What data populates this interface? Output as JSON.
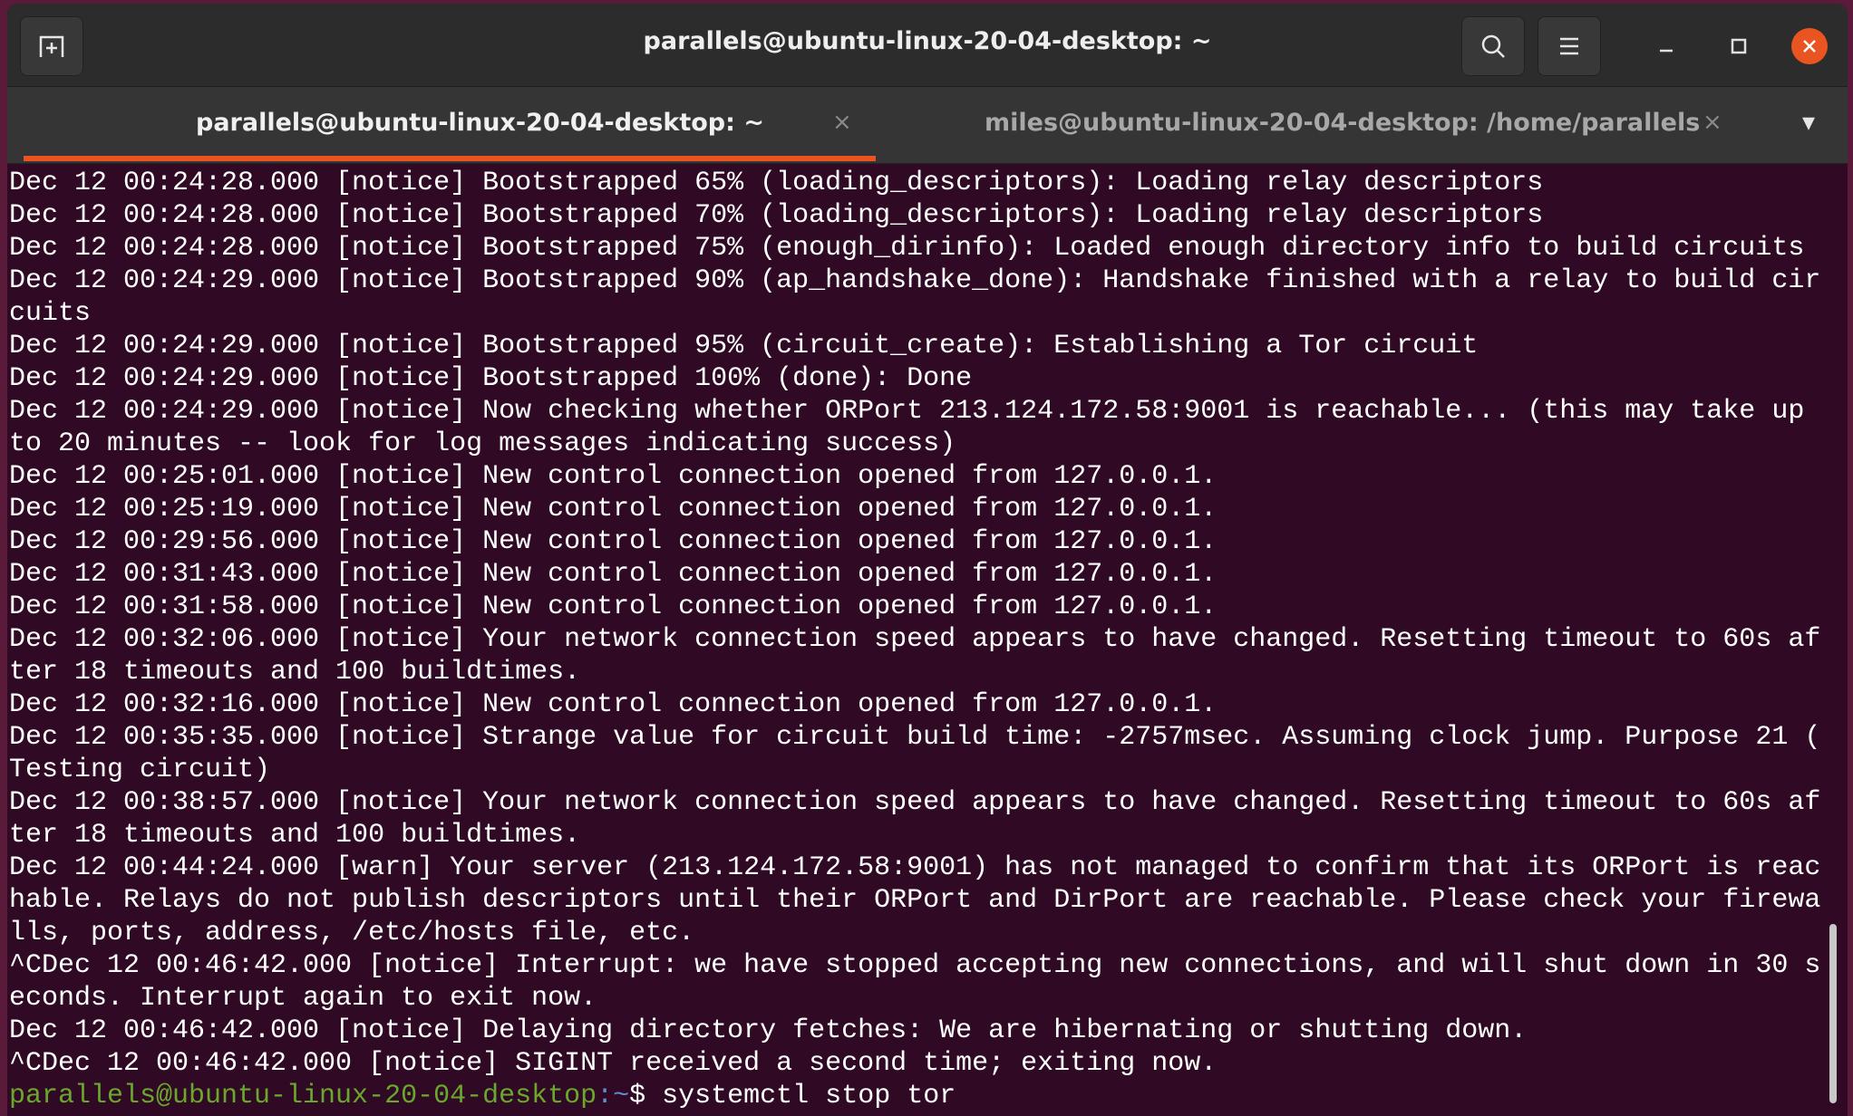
{
  "window": {
    "title": "parallels@ubuntu-linux-20-04-desktop: ~",
    "icons": {
      "new_tab": "new-tab-icon",
      "search": "search-icon",
      "menu": "hamburger-menu-icon",
      "minimize": "minimize-icon",
      "maximize": "maximize-icon",
      "close": "close-icon"
    },
    "accent": "#e95420",
    "background": "#300a24"
  },
  "tabs": [
    {
      "label": "parallels@ubuntu-linux-20-04-desktop: ~",
      "close": "×",
      "active": true
    },
    {
      "label": "miles@ubuntu-linux-20-04-desktop: /home/parallels",
      "close": "×",
      "active": false
    }
  ],
  "tab_dropdown": "▾",
  "terminal": {
    "lines": [
      "Dec 12 00:24:28.000 [notice] Bootstrapped 65% (loading_descriptors): Loading relay descriptors",
      "Dec 12 00:24:28.000 [notice] Bootstrapped 70% (loading_descriptors): Loading relay descriptors",
      "Dec 12 00:24:28.000 [notice] Bootstrapped 75% (enough_dirinfo): Loaded enough directory info to build circuits",
      "Dec 12 00:24:29.000 [notice] Bootstrapped 90% (ap_handshake_done): Handshake finished with a relay to build cir",
      "cuits",
      "Dec 12 00:24:29.000 [notice] Bootstrapped 95% (circuit_create): Establishing a Tor circuit",
      "Dec 12 00:24:29.000 [notice] Bootstrapped 100% (done): Done",
      "Dec 12 00:24:29.000 [notice] Now checking whether ORPort 213.124.172.58:9001 is reachable... (this may take up",
      "to 20 minutes -- look for log messages indicating success)",
      "Dec 12 00:25:01.000 [notice] New control connection opened from 127.0.0.1.",
      "Dec 12 00:25:19.000 [notice] New control connection opened from 127.0.0.1.",
      "Dec 12 00:29:56.000 [notice] New control connection opened from 127.0.0.1.",
      "Dec 12 00:31:43.000 [notice] New control connection opened from 127.0.0.1.",
      "Dec 12 00:31:58.000 [notice] New control connection opened from 127.0.0.1.",
      "Dec 12 00:32:06.000 [notice] Your network connection speed appears to have changed. Resetting timeout to 60s af",
      "ter 18 timeouts and 100 buildtimes.",
      "Dec 12 00:32:16.000 [notice] New control connection opened from 127.0.0.1.",
      "Dec 12 00:35:35.000 [notice] Strange value for circuit build time: -2757msec. Assuming clock jump. Purpose 21 (",
      "Testing circuit)",
      "Dec 12 00:38:57.000 [notice] Your network connection speed appears to have changed. Resetting timeout to 60s af",
      "ter 18 timeouts and 100 buildtimes.",
      "Dec 12 00:44:24.000 [warn] Your server (213.124.172.58:9001) has not managed to confirm that its ORPort is reac",
      "hable. Relays do not publish descriptors until their ORPort and DirPort are reachable. Please check your firewa",
      "lls, ports, address, /etc/hosts file, etc.",
      "^CDec 12 00:46:42.000 [notice] Interrupt: we have stopped accepting new connections, and will shut down in 30 s",
      "econds. Interrupt again to exit now.",
      "Dec 12 00:46:42.000 [notice] Delaying directory fetches: We are hibernating or shutting down.",
      "^CDec 12 00:46:42.000 [notice] SIGINT received a second time; exiting now."
    ],
    "prompt": {
      "user_host": "parallels@ubuntu-linux-20-04-desktop",
      "sep": ":",
      "path": "~",
      "symbol": "$ ",
      "command": "systemctl stop tor"
    }
  }
}
